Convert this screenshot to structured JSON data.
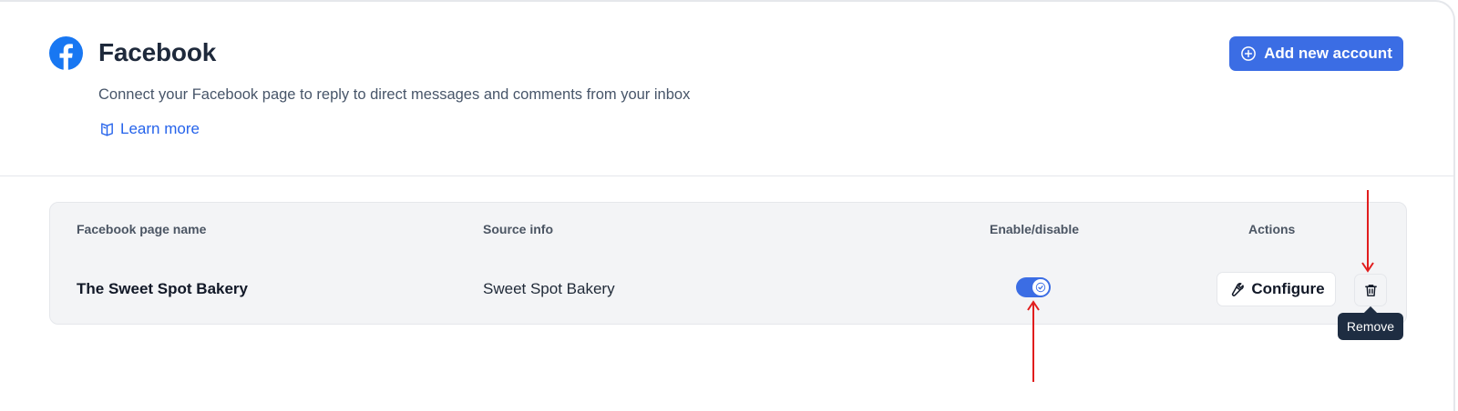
{
  "header": {
    "title": "Facebook",
    "description": "Connect your Facebook page to reply to direct messages and comments from your inbox",
    "learn_more": "Learn more",
    "add_button": "Add new account"
  },
  "table": {
    "columns": [
      "Facebook page name",
      "Source info",
      "Enable/disable",
      "Actions"
    ],
    "rows": [
      {
        "page_name": "The Sweet Spot Bakery",
        "source_info": "Sweet Spot Bakery",
        "enabled": true
      }
    ],
    "configure_label": "Configure",
    "tooltip": "Remove"
  },
  "icons": {
    "logo": "facebook-logo-icon",
    "learn": "book-icon",
    "add": "plus-circle-icon",
    "configure": "wrench-icon",
    "remove": "trash-icon",
    "toggle": "check-icon"
  },
  "colors": {
    "accent": "#3b6de4",
    "facebook": "#1877f2",
    "link": "#2563eb",
    "tooltip_bg": "#1e2d42",
    "annotation": "#e11d1d"
  }
}
